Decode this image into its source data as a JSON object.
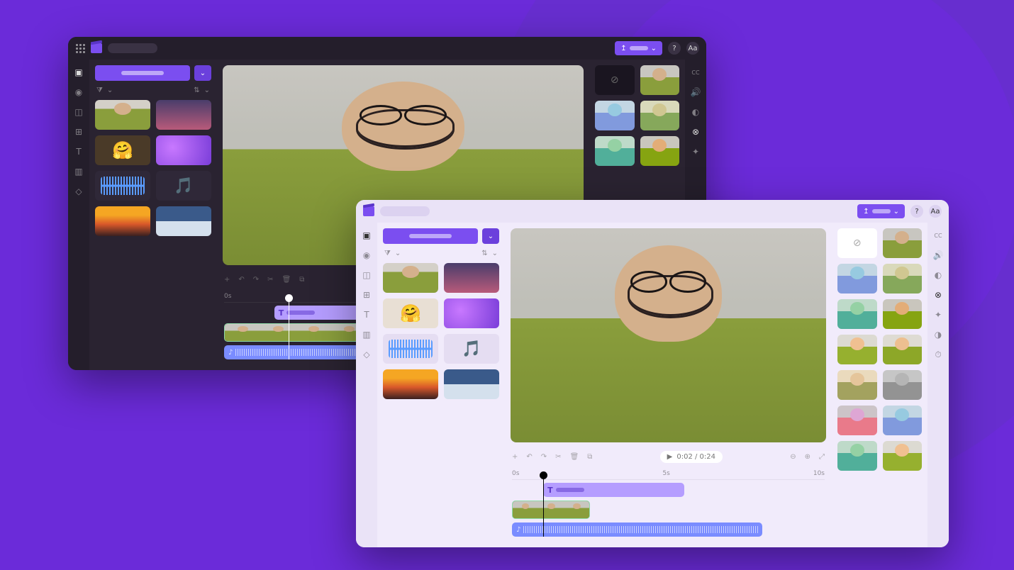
{
  "playback": {
    "time_label": "0:02 / 0:24"
  },
  "timeline": {
    "ticks": [
      "0s",
      "5s",
      "10s"
    ]
  },
  "emoji": {
    "hug": "🤗",
    "note": "🎵"
  },
  "icons": {
    "help": "?",
    "text_size": "Aa",
    "chevron_down": "⌄",
    "filter": "⧩",
    "sort": "⇅",
    "scissors": "✂",
    "undo": "↶",
    "redo": "↷",
    "trash": "🗑",
    "play": "▶",
    "zoom_in": "⊕",
    "zoom_out": "⊖",
    "fit": "⤢",
    "no_filter": "⊘",
    "text_t": "T",
    "upload": "↥"
  },
  "left_rail": [
    {
      "name": "media",
      "glyph": "▣"
    },
    {
      "name": "record",
      "glyph": "◉"
    },
    {
      "name": "overlay",
      "glyph": "◫"
    },
    {
      "name": "templates",
      "glyph": "⊞"
    },
    {
      "name": "text",
      "glyph": "T"
    },
    {
      "name": "transitions",
      "glyph": "▥"
    },
    {
      "name": "brand",
      "glyph": "◇"
    }
  ],
  "right_rail": [
    {
      "name": "captions",
      "glyph": "CC"
    },
    {
      "name": "audio",
      "glyph": "🔊"
    },
    {
      "name": "color",
      "glyph": "◐"
    },
    {
      "name": "filters",
      "glyph": "⊗"
    },
    {
      "name": "effects",
      "glyph": "✦"
    },
    {
      "name": "adjust",
      "glyph": "◑"
    },
    {
      "name": "speed",
      "glyph": "⏱"
    }
  ]
}
